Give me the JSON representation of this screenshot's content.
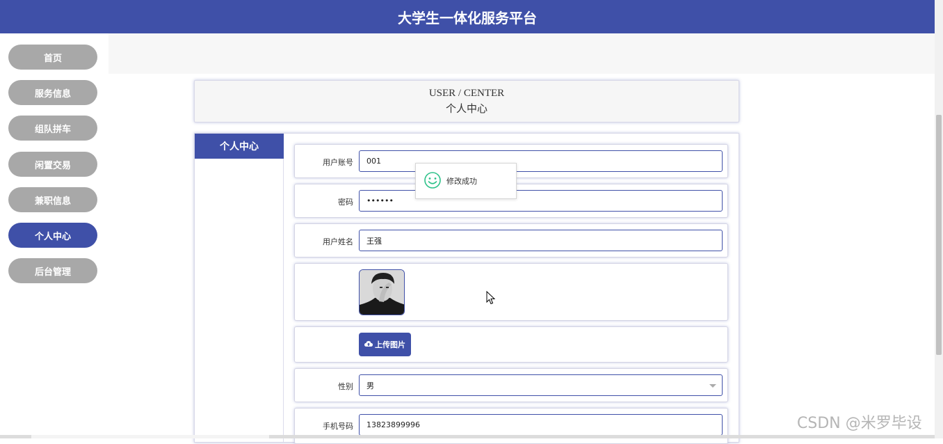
{
  "header": {
    "title": "大学生一体化服务平台"
  },
  "sidebar": {
    "items": [
      {
        "label": "首页",
        "active": false
      },
      {
        "label": "服务信息",
        "active": false
      },
      {
        "label": "组队拼车",
        "active": false
      },
      {
        "label": "闲置交易",
        "active": false
      },
      {
        "label": "兼职信息",
        "active": false
      },
      {
        "label": "个人中心",
        "active": true
      },
      {
        "label": "后台管理",
        "active": false
      }
    ]
  },
  "page": {
    "title_en": "USER / CENTER",
    "title_cn": "个人中心"
  },
  "panel": {
    "side_tab": "个人中心"
  },
  "form": {
    "account": {
      "label": "用户账号",
      "value": "001"
    },
    "password": {
      "label": "密码",
      "value": "••••••"
    },
    "name": {
      "label": "用户姓名",
      "value": "王强"
    },
    "upload_label": "上传图片",
    "gender": {
      "label": "性别",
      "value": "男"
    },
    "phone": {
      "label": "手机号码",
      "value": "13823899996"
    }
  },
  "toast": {
    "message": "修改成功",
    "icon": "smile-icon"
  },
  "watermark": "CSDN @米罗毕设",
  "colors": {
    "primary": "#3f50a8",
    "nav_inactive": "#a8a8a8",
    "toast_icon": "#2ec28a"
  }
}
